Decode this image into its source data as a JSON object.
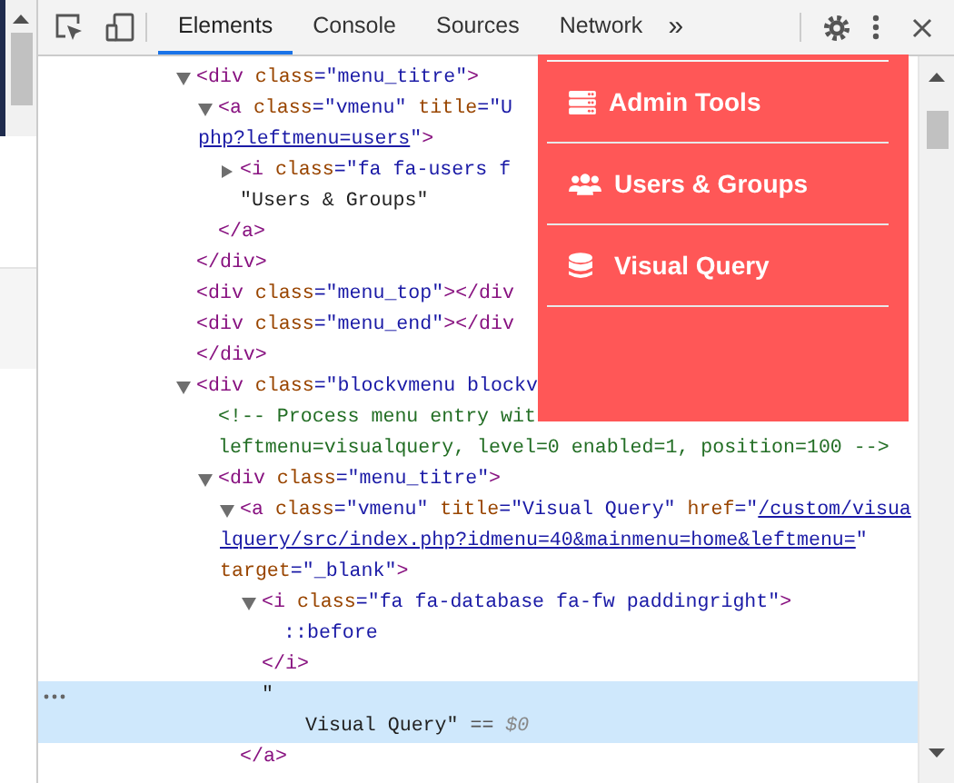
{
  "toolbar": {
    "tabs": [
      {
        "label": "Elements",
        "selected": true
      },
      {
        "label": "Console",
        "selected": false
      },
      {
        "label": "Sources",
        "selected": false
      },
      {
        "label": "Network",
        "selected": false
      }
    ],
    "more_tabs": "»"
  },
  "tree": [
    {
      "children": [
        {
          "expanded": true,
          "selected": false,
          "lines": [
            [
              {
                "kind": "tag",
                "text": "<div"
              },
              {
                "kind": "attr",
                "text": " class"
              },
              {
                "kind": "value",
                "text": "=\"menu_titre\""
              },
              {
                "kind": "tag",
                "text": ">"
              }
            ]
          ],
          "children": [
            {
              "expanded": true,
              "selected": false,
              "lines": [
                [
                  {
                    "kind": "tag",
                    "text": "<a"
                  },
                  {
                    "kind": "attr",
                    "text": " class"
                  },
                  {
                    "kind": "value",
                    "text": "=\"vmenu\""
                  },
                  {
                    "kind": "attr",
                    "text": " title"
                  },
                  {
                    "kind": "value",
                    "text": "=\"U"
                  }
                ],
                [
                  {
                    "kind": "link",
                    "text": "php?leftmenu=users"
                  },
                  {
                    "kind": "value",
                    "text": "\""
                  },
                  {
                    "kind": "tag",
                    "text": ">"
                  }
                ]
              ],
              "children": [
                {
                  "expanded": false,
                  "selected": false,
                  "lines": [
                    [
                      {
                        "kind": "tag",
                        "text": "<i"
                      },
                      {
                        "kind": "attr",
                        "text": " class"
                      },
                      {
                        "kind": "value",
                        "text": "=\"fa fa-users f"
                      }
                    ]
                  ]
                },
                {
                  "selected": false,
                  "lines": [
                    [
                      {
                        "kind": "text",
                        "text": "\"Users & Groups\""
                      }
                    ]
                  ]
                }
              ]
            },
            {
              "selected": false,
              "lines": [
                [
                  {
                    "kind": "tag",
                    "text": "</a>"
                  }
                ]
              ]
            }
          ]
        },
        {
          "selected": false,
          "lines": [
            [
              {
                "kind": "tag",
                "text": "</div>"
              }
            ]
          ]
        },
        {
          "selected": false,
          "lines": [
            [
              {
                "kind": "tag",
                "text": "<div"
              },
              {
                "kind": "attr",
                "text": " class"
              },
              {
                "kind": "value",
                "text": "=\"menu_top\""
              },
              {
                "kind": "tag",
                "text": "></div"
              }
            ]
          ]
        },
        {
          "selected": false,
          "lines": [
            [
              {
                "kind": "tag",
                "text": "<div"
              },
              {
                "kind": "attr",
                "text": " class"
              },
              {
                "kind": "value",
                "text": "=\"menu_end\""
              },
              {
                "kind": "tag",
                "text": "></div"
              }
            ]
          ]
        }
      ]
    },
    {
      "selected": false,
      "lines": [
        [
          {
            "kind": "tag",
            "text": "</div>"
          }
        ]
      ]
    },
    {
      "expanded": true,
      "selected": false,
      "lines": [
        [
          {
            "kind": "tag",
            "text": "<div"
          },
          {
            "kind": "attr",
            "text": " class"
          },
          {
            "kind": "value",
            "text": "=\"blockvmenu blockv"
          }
        ]
      ],
      "children": [
        {
          "selected": false,
          "lines": [
            [
              {
                "kind": "comment",
                "text": "<!-- Process menu entry wit"
              }
            ],
            [
              {
                "kind": "comment",
                "text": "leftmenu=visualquery, level=0 enabled=1, position=100 -->"
              }
            ]
          ]
        },
        {
          "expanded": true,
          "selected": false,
          "lines": [
            [
              {
                "kind": "tag",
                "text": "<div"
              },
              {
                "kind": "attr",
                "text": " class"
              },
              {
                "kind": "value",
                "text": "=\"menu_titre\""
              },
              {
                "kind": "tag",
                "text": ">"
              }
            ]
          ],
          "children": [
            {
              "expanded": true,
              "selected": false,
              "lines": [
                [
                  {
                    "kind": "tag",
                    "text": "<a"
                  },
                  {
                    "kind": "attr",
                    "text": " class"
                  },
                  {
                    "kind": "value",
                    "text": "=\"vmenu\""
                  },
                  {
                    "kind": "attr",
                    "text": " title"
                  },
                  {
                    "kind": "value",
                    "text": "=\"Visual Query\""
                  },
                  {
                    "kind": "attr",
                    "text": " href"
                  },
                  {
                    "kind": "value",
                    "text": "=\""
                  },
                  {
                    "kind": "link",
                    "text": "/custom/visua"
                  }
                ],
                [
                  {
                    "kind": "link",
                    "text": "lquery/src/index.php?idmenu=40&mainmenu=home&leftmenu="
                  },
                  {
                    "kind": "value",
                    "text": "\""
                  }
                ],
                [
                  {
                    "kind": "attr",
                    "text": "target"
                  },
                  {
                    "kind": "value",
                    "text": "=\"_blank\""
                  },
                  {
                    "kind": "tag",
                    "text": ">"
                  }
                ]
              ],
              "children": [
                {
                  "expanded": true,
                  "selected": false,
                  "lines": [
                    [
                      {
                        "kind": "tag",
                        "text": "<i"
                      },
                      {
                        "kind": "attr",
                        "text": " class"
                      },
                      {
                        "kind": "value",
                        "text": "=\"fa fa-database fa-fw paddingright\""
                      },
                      {
                        "kind": "tag",
                        "text": ">"
                      }
                    ]
                  ],
                  "children": [
                    {
                      "selected": false,
                      "lines": [
                        [
                          {
                            "kind": "pseudo",
                            "text": "::before"
                          }
                        ]
                      ]
                    }
                  ]
                },
                {
                  "selected": false,
                  "lines": [
                    [
                      {
                        "kind": "tag",
                        "text": "</i>"
                      }
                    ]
                  ]
                },
                {
                  "selected": true,
                  "lines": [
                    [
                      {
                        "kind": "text",
                        "text": "\""
                      }
                    ],
                    [
                      {
                        "kind": "text",
                        "text": "Visual Query\""
                      },
                      {
                        "kind": "plain",
                        "text": " == "
                      },
                      {
                        "kind": "var",
                        "text": "$0"
                      }
                    ]
                  ]
                }
              ]
            },
            {
              "selected": false,
              "lines": [
                [
                  {
                    "kind": "tag",
                    "text": "</a>"
                  }
                ]
              ]
            }
          ]
        }
      ]
    }
  ],
  "popup_menu": {
    "items": [
      {
        "label": "Admin Tools"
      },
      {
        "label": "Users & Groups"
      },
      {
        "label": "Visual Query"
      }
    ]
  }
}
